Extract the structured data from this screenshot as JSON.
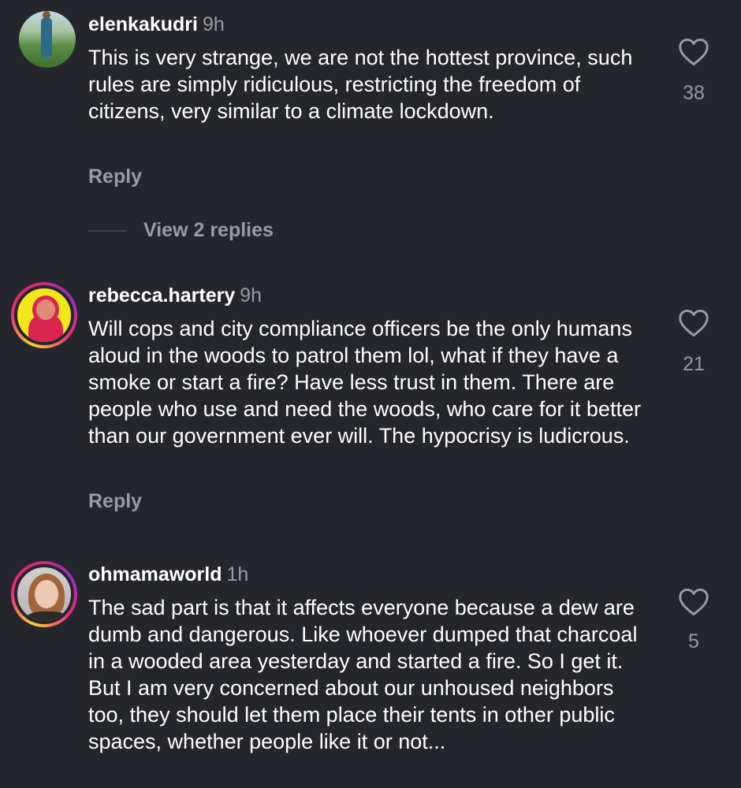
{
  "comments": [
    {
      "username": "elenkakudri",
      "time": "9h",
      "text": "This is very strange, we are not the hottest province, such rules are simply ridiculous, restricting the freedom of citizens, very similar to a climate lockdown.",
      "reply_label": "Reply",
      "likes": "38",
      "view_replies": "View 2 replies"
    },
    {
      "username": "rebecca.hartery",
      "time": "9h",
      "text": "Will cops and city compliance officers be the only humans aloud in the woods to patrol them lol, what if they have a smoke or start a fire? Have less trust in them. There are people who use and need the woods, who care for it better than our government ever will. The hypocrisy is ludicrous.",
      "reply_label": "Reply",
      "likes": "21"
    },
    {
      "username": "ohmamaworld",
      "time": "1h",
      "text": "The sad part is that it affects everyone because a dew are dumb and dangerous. Like whoever dumped that charcoal in a wooded area yesterday and started a fire. So I get it. But I am very concerned about our unhoused neighbors too, they should let them place their tents in other public spaces, whether people like it or not...",
      "likes": "5"
    }
  ],
  "icons": {
    "like": "heart-outline-icon"
  },
  "colors": {
    "background": "#24262b",
    "secondary_text": "#9a9ca1",
    "story_ring_start": "#f9ce34",
    "story_ring_end": "#ee2a7b"
  }
}
